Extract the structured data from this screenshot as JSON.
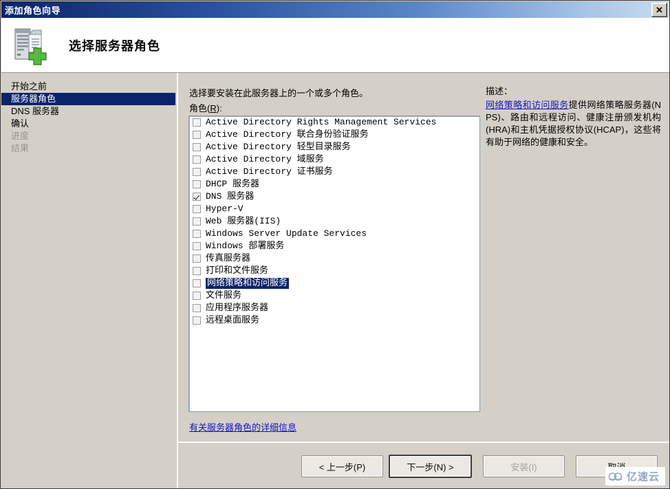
{
  "window": {
    "title": "添加角色向导",
    "close_label": "✕"
  },
  "header": {
    "title": "选择服务器角色",
    "icon": "server-add-icon"
  },
  "sidebar": {
    "items": [
      {
        "label": "开始之前",
        "state": "normal"
      },
      {
        "label": "服务器角色",
        "state": "selected"
      },
      {
        "label": "DNS 服务器",
        "state": "normal"
      },
      {
        "label": "确认",
        "state": "normal"
      },
      {
        "label": "进度",
        "state": "disabled"
      },
      {
        "label": "结果",
        "state": "disabled"
      }
    ]
  },
  "main": {
    "intro": "选择要安装在此服务器上的一个或多个角色。",
    "roles_label_prefix": "角色(",
    "roles_label_accel": "R",
    "roles_label_suffix": "):",
    "roles": [
      {
        "label": "Active Directory Rights Management Services",
        "checked": false,
        "highlighted": false
      },
      {
        "label": "Active Directory 联合身份验证服务",
        "checked": false,
        "highlighted": false
      },
      {
        "label": "Active Directory 轻型目录服务",
        "checked": false,
        "highlighted": false
      },
      {
        "label": "Active Directory 域服务",
        "checked": false,
        "highlighted": false
      },
      {
        "label": "Active Directory 证书服务",
        "checked": false,
        "highlighted": false
      },
      {
        "label": "DHCP 服务器",
        "checked": false,
        "highlighted": false
      },
      {
        "label": "DNS 服务器",
        "checked": true,
        "highlighted": false
      },
      {
        "label": "Hyper-V",
        "checked": false,
        "highlighted": false
      },
      {
        "label": "Web 服务器(IIS)",
        "checked": false,
        "highlighted": false
      },
      {
        "label": "Windows Server Update Services",
        "checked": false,
        "highlighted": false
      },
      {
        "label": "Windows 部署服务",
        "checked": false,
        "highlighted": false
      },
      {
        "label": "传真服务器",
        "checked": false,
        "highlighted": false
      },
      {
        "label": "打印和文件服务",
        "checked": false,
        "highlighted": false
      },
      {
        "label": "网络策略和访问服务",
        "checked": false,
        "highlighted": true
      },
      {
        "label": "文件服务",
        "checked": false,
        "highlighted": false
      },
      {
        "label": "应用程序服务器",
        "checked": false,
        "highlighted": false
      },
      {
        "label": "远程桌面服务",
        "checked": false,
        "highlighted": false
      }
    ],
    "more_info_link": "有关服务器角色的详细信息"
  },
  "description": {
    "title": "描述：",
    "link_text": "网络策略和访问服务",
    "body_text": "提供网络策略服务器(NPS)、路由和远程访问、健康注册颁发机构(HRA)和主机凭据授权协议(HCAP)，这些将有助于网络的健康和安全。"
  },
  "footer": {
    "back": "< 上一步(P)",
    "next": "下一步(N) >",
    "install": "安装(I)",
    "cancel": "取消"
  },
  "watermark": {
    "text": "亿速云"
  },
  "colors": {
    "title_bar_start": "#0a246a",
    "title_bar_end": "#c9dcf0",
    "dialog_face": "#d4d0c8",
    "selection": "#0a246a",
    "link": "#1414c8",
    "disabled_text": "#9a968e"
  }
}
